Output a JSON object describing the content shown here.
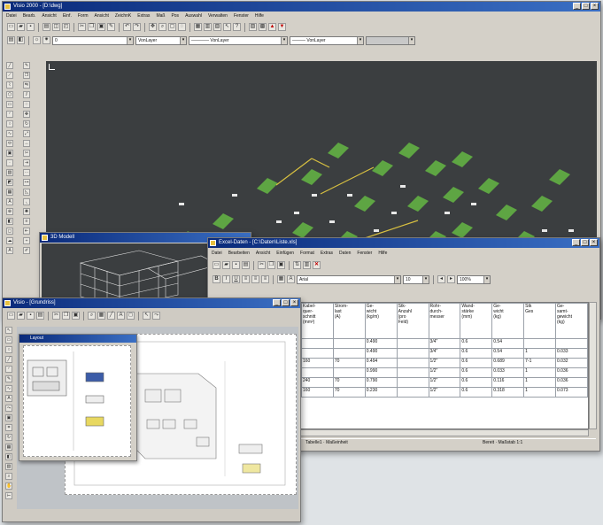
{
  "main_window": {
    "title": "Visio 2000 - [D:\\dwg]",
    "menu": [
      "Datei",
      "Bearb.",
      "Ansicht",
      "Einf.",
      "Form",
      "Ansicht",
      "ZeichnK",
      "Extras",
      "Maß",
      "Pos",
      "Auswahl",
      "Verwalten",
      "Fenster",
      "Hilfe"
    ],
    "layer_value": "0",
    "color_value": "VonLayer",
    "linetype_value": "VonLayer",
    "lineweight_value": "VonLayer"
  },
  "model_window": {
    "title": "3D Modell"
  },
  "data_window": {
    "title": "Excel-Daten - [C:\\Daten\\Liste.xls]",
    "menu": [
      "Datei",
      "Bearbeiten",
      "Ansicht",
      "Einfügen",
      "Format",
      "Extras",
      "Daten",
      "Fenster",
      "Hilfe"
    ],
    "font_value": "Arial",
    "size_value": "10",
    "zoom_value": "100%",
    "columns": [
      "Kabel-\nquer-\nschnitt\n(mm²)",
      "Strom-\nlast\n(A)",
      "Ge-\nwicht\n(kg/m)",
      "Stk-\nAnzahl\n(pro\nFeld)",
      "Rohr-\ndurch-\nmesser",
      "Wand-\nstärke\n(mm)",
      "Ge-\nwicht\n(kg)",
      "Stk\nGes",
      "Ge-\nsamt-\ngewicht\n(kg)"
    ],
    "rows": [
      [
        "",
        "",
        "0.490",
        "",
        "3/4\"",
        "0.6",
        "0.54",
        "",
        ""
      ],
      [
        "",
        "",
        "0.490",
        "",
        "3/4\"",
        "0.6",
        "0.54",
        "1",
        "0.033"
      ],
      [
        "160",
        "70",
        "0.494",
        "",
        "1/2\"",
        "0.6",
        "0.689",
        "7-1",
        "0.032"
      ],
      [
        "",
        "",
        "0.990",
        "",
        "1/2\"",
        "0.6",
        "0.033",
        "1",
        "0.036"
      ],
      [
        "240",
        "70",
        "0.790",
        "",
        "1/2\"",
        "0.6",
        "0.116",
        "1",
        "0.036"
      ],
      [
        "160",
        "70",
        "0.230",
        "",
        "1/2\"",
        "0.6",
        "0.318",
        "1",
        "0.073"
      ]
    ],
    "status_left": "Tabelle1 · Maßeinheit",
    "status_right": "Bereit · Maßstab 1:1"
  },
  "plan_window": {
    "title": "Visio - [Grundriss]",
    "sub_title": "Layout"
  },
  "colors": {
    "titlebar": "#0a2a7a",
    "canvas": "#3b3e40",
    "foliage": "#5ea543"
  }
}
